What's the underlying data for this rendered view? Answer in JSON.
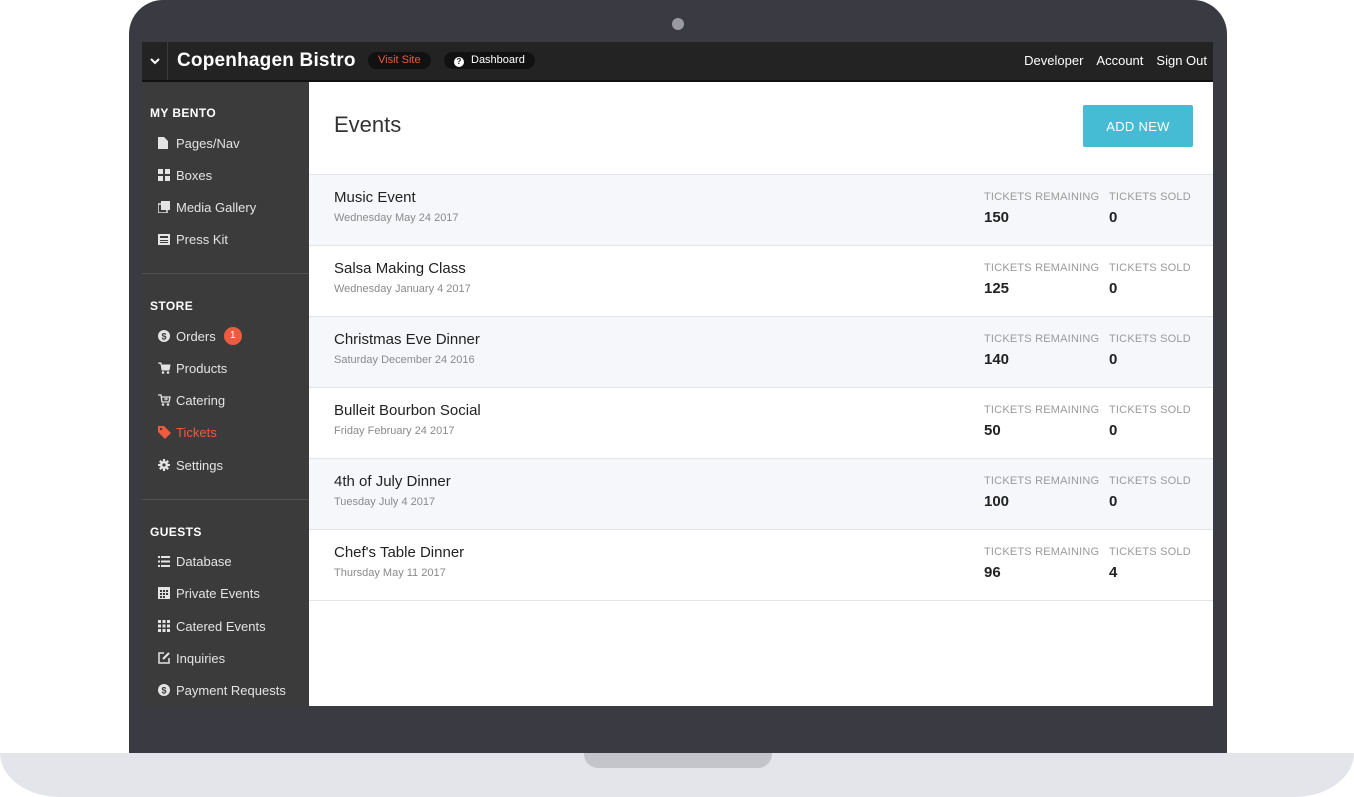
{
  "topbar": {
    "site_title": "Copenhagen Bistro",
    "visit_site": "Visit Site",
    "dashboard": "Dashboard",
    "links": [
      "Developer",
      "Account",
      "Sign Out"
    ]
  },
  "sidebar": {
    "my_bento": {
      "title": "MY BENTO",
      "items": [
        {
          "label": "Pages/Nav",
          "icon": "file-icon"
        },
        {
          "label": "Boxes",
          "icon": "grid-icon"
        },
        {
          "label": "Media Gallery",
          "icon": "gallery-icon"
        },
        {
          "label": "Press Kit",
          "icon": "newspaper-icon"
        }
      ]
    },
    "store": {
      "title": "STORE",
      "items": [
        {
          "label": "Orders",
          "icon": "dollar-icon",
          "badge": "1"
        },
        {
          "label": "Products",
          "icon": "cart-icon"
        },
        {
          "label": "Catering",
          "icon": "cart-plus-icon"
        },
        {
          "label": "Tickets",
          "icon": "tag-icon",
          "active": true
        },
        {
          "label": "Settings",
          "icon": "gear-icon"
        }
      ]
    },
    "guests": {
      "title": "GUESTS",
      "items": [
        {
          "label": "Database",
          "icon": "list-icon"
        },
        {
          "label": "Private Events",
          "icon": "calendar-icon"
        },
        {
          "label": "Catered Events",
          "icon": "grid-dots-icon"
        },
        {
          "label": "Inquiries",
          "icon": "edit-icon"
        },
        {
          "label": "Payment Requests",
          "icon": "dollar-icon"
        }
      ]
    }
  },
  "main": {
    "title": "Events",
    "add_button": "ADD NEW",
    "col_remaining": "TICKETS REMAINING",
    "col_sold": "TICKETS SOLD",
    "events": [
      {
        "name": "Music Event",
        "date": "Wednesday May 24 2017",
        "remaining": "150",
        "sold": "0"
      },
      {
        "name": "Salsa Making Class",
        "date": "Wednesday January 4 2017",
        "remaining": "125",
        "sold": "0"
      },
      {
        "name": "Christmas Eve Dinner",
        "date": "Saturday December 24 2016",
        "remaining": "140",
        "sold": "0"
      },
      {
        "name": "Bulleit Bourbon Social",
        "date": "Friday February 24 2017",
        "remaining": "50",
        "sold": "0"
      },
      {
        "name": "4th of July Dinner",
        "date": "Tuesday July 4 2017",
        "remaining": "100",
        "sold": "0"
      },
      {
        "name": "Chef's Table Dinner",
        "date": "Thursday May 11 2017",
        "remaining": "96",
        "sold": "4"
      }
    ]
  },
  "colors": {
    "accent": "#ef5b3f",
    "button": "#45bcd3",
    "sidebar": "#3b3b3b",
    "topbar": "#232323"
  }
}
